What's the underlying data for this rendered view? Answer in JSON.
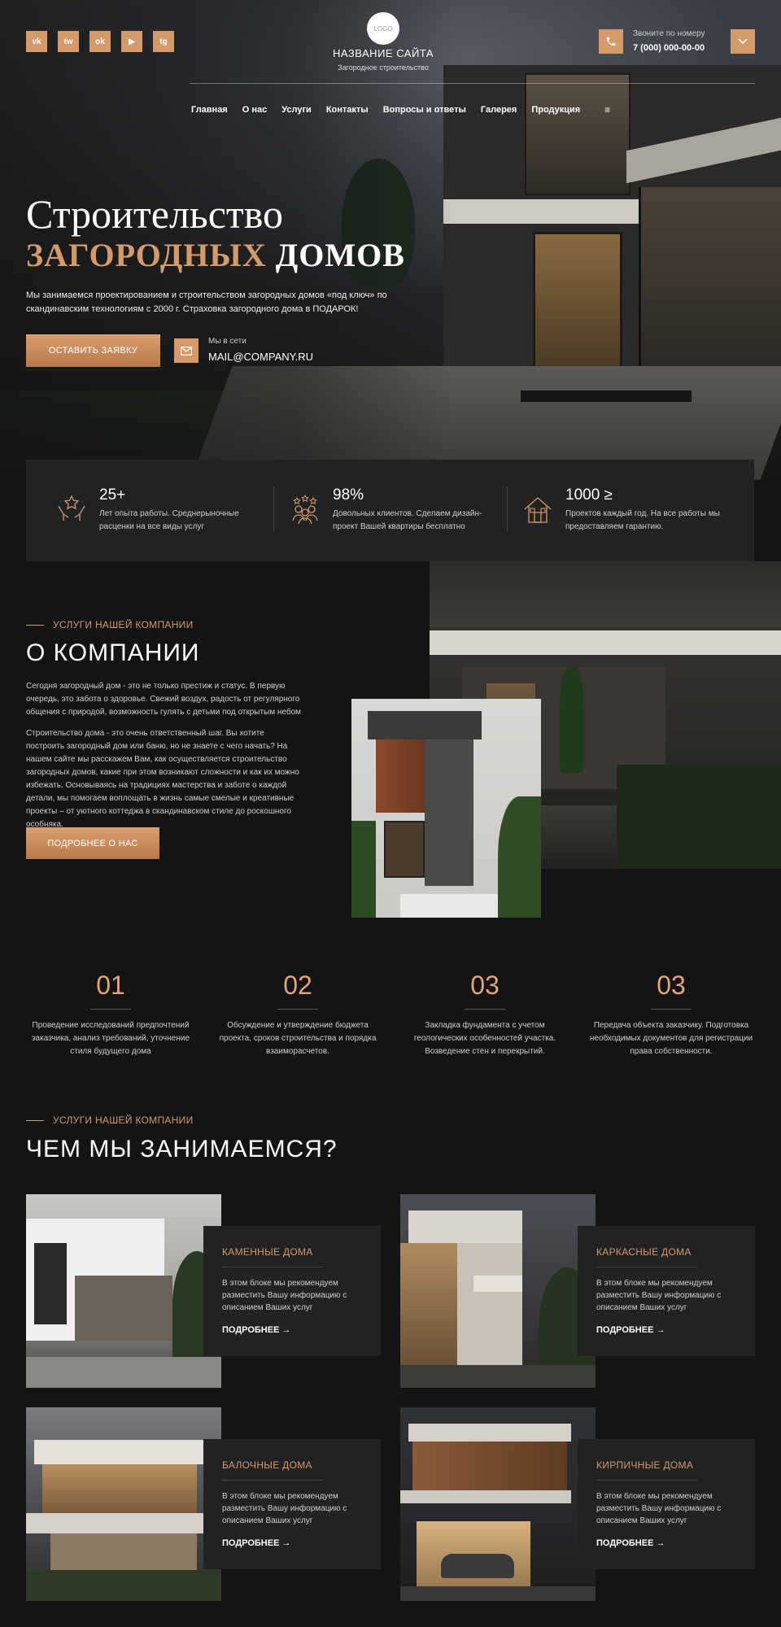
{
  "colors": {
    "accent": "#d49a6a",
    "background": "#141414",
    "card": "#222222"
  },
  "header": {
    "social": [
      {
        "label": "vk",
        "icon": "vk-icon"
      },
      {
        "label": "tw",
        "icon": "twitter-icon"
      },
      {
        "label": "ok",
        "icon": "odnoklassniki-icon"
      },
      {
        "label": "▶",
        "icon": "youtube-icon"
      },
      {
        "label": "tg",
        "icon": "telegram-icon"
      }
    ],
    "logo": "LOGO",
    "site_title": "НАЗВАНИЕ САЙТА",
    "site_subtitle": "Загородное строительство",
    "phone_label": "Звоните по номеру",
    "phone": "7 (000) 000-00-00"
  },
  "nav": {
    "items": [
      "Главная",
      "О нас",
      "Услуги",
      "Контакты",
      "Вопросы и ответы",
      "Галерея",
      "Продукция"
    ],
    "more": "≡"
  },
  "hero": {
    "title_line1": "Строительство",
    "title_accent": "ЗАГОРОДНЫХ",
    "title_rest": "ДОМОВ",
    "description": "Мы занимаемся проектированием и строительством загородных домов «под ключ» по скандинавским технологиям с 2000 г. Страховка загородного дома в ПОДАРОК!",
    "cta": "ОСТАВИТЬ ЗАЯВКУ",
    "mail_label": "Мы в сети",
    "mail": "MAIL@COMPANY.RU"
  },
  "stats": [
    {
      "value": "25+",
      "text": "Лет опыта работы. Среднерыночные расценки на все виды услуг",
      "icon": "hands-star-icon"
    },
    {
      "value": "98%",
      "text": "Довольных клиентов. Сделаем дизайн-проект Вашей квартиры бесплатно",
      "icon": "people-stars-icon"
    },
    {
      "value": "1000 ≥",
      "text": "Проектов каждый год. На все работы мы предоставляем гарантию.",
      "icon": "house-icon"
    }
  ],
  "about": {
    "eyebrow": "УСЛУГИ НАШЕЙ КОМПАНИИ",
    "title": "О КОМПАНИИ",
    "p1": "Сегодня загородный дом - это не только престиж и статус. В первую очередь, это забота о здоровье. Свежий воздух, радость от регулярного общения с природой, возможность гулять с детьми под открытым небом",
    "p2": "Строительство дома - это очень ответственный шаг. Вы хотите построить загородный дом или баню, но не знаете с чего начать? На нашем сайте мы расскажем Вам, как осуществляется строительство загородных домов, какие при этом возникают сложности и как их можно избежать. Основываясь на традициях мастерства и заботе о каждой детали, мы помогаем воплощать в жизнь самые смелые и креативные проекты – от уютного коттеджа в скандинавском стиле до роскошного особняка.",
    "button": "ПОДРОБНЕЕ О НАС"
  },
  "steps": [
    {
      "num": "01",
      "text": "Проведение исследований предпочтений заказчика, анализ требований, уточнение стиля будущего дома"
    },
    {
      "num": "02",
      "text": "Обсуждение и утверждение бюджета проекта, сроков строительства и порядка взаиморасчетов."
    },
    {
      "num": "03",
      "text": "Закладка фундамента с учетом геологических особенностей участка. Возведение стен и перекрытий."
    },
    {
      "num": "03",
      "text": "Передача объекта заказчику. Подготовка необходимых документов для регистрации права собственности."
    }
  ],
  "services": {
    "eyebrow": "УСЛУГИ НАШЕЙ КОМПАНИИ",
    "title": "ЧЕМ МЫ ЗАНИМАЕМСЯ?",
    "items": [
      {
        "title": "КАМЕННЫЕ ДОМА",
        "text": "В этом блоке мы рекомендуем разместить Вашу информацию с описанием Ваших услуг",
        "more": "ПОДРОБНЕЕ →"
      },
      {
        "title": "КАРКАСНЫЕ ДОМА",
        "text": "В этом блоке мы рекомендуем разместить Вашу информацию с описанием Ваших услуг",
        "more": "ПОДРОБНЕЕ →"
      },
      {
        "title": "БАЛОЧНЫЕ ДОМА",
        "text": "В этом блоке мы рекомендуем разместить Вашу информацию с описанием Ваших услуг",
        "more": "ПОДРОБНЕЕ →"
      },
      {
        "title": "КИРПИЧНЫЕ ДОМА",
        "text": "В этом блоке мы рекомендуем разместить Вашу информацию с описанием Ваших услуг",
        "more": "ПОДРОБНЕЕ →"
      }
    ]
  }
}
